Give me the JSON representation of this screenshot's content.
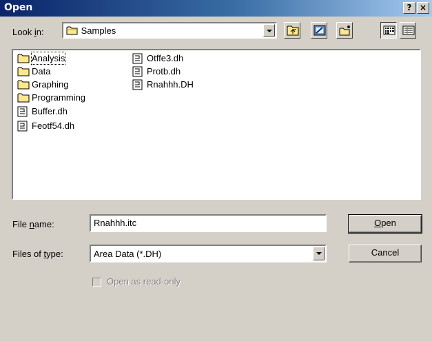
{
  "window": {
    "title": "Open"
  },
  "titlebar": {
    "help_label": "?",
    "close_label": "×"
  },
  "lookin": {
    "label_pre": "Look ",
    "label_u": "i",
    "label_post": "n:",
    "value": "Samples",
    "folder_icon": "folder-icon"
  },
  "toolbar": {
    "buttons": [
      "up-one-level",
      "desktop",
      "new-folder",
      "list-view",
      "details-view"
    ],
    "active_view": "list-view"
  },
  "files": {
    "column1": [
      {
        "name": "Analysis",
        "icon": "folder-icon"
      },
      {
        "name": "Data",
        "icon": "folder-icon"
      },
      {
        "name": "Graphing",
        "icon": "folder-icon"
      },
      {
        "name": "Programming",
        "icon": "folder-icon"
      },
      {
        "name": "Buffer.dh",
        "icon": "document-icon"
      },
      {
        "name": "Feotf54.dh",
        "icon": "document-icon"
      }
    ],
    "column2": [
      {
        "name": "Otffe3.dh",
        "icon": "document-icon"
      },
      {
        "name": "Protb.dh",
        "icon": "document-icon"
      },
      {
        "name": "Rnahhh.DH",
        "icon": "document-icon"
      }
    ]
  },
  "filename": {
    "label_pre": "File ",
    "label_u": "n",
    "label_post": "ame:",
    "value": "Rnahhh.itc"
  },
  "filetype": {
    "label_pre": "Files of ",
    "label_u": "t",
    "label_post": "ype:",
    "value": "Area Data (*.DH)"
  },
  "buttons": {
    "open_u": "O",
    "open_rest": "pen",
    "cancel": "Cancel"
  },
  "readonly": {
    "label": "Open as read-only",
    "checked": false,
    "enabled": false
  },
  "colors": {
    "titlebar_start": "#0a246a",
    "titlebar_end": "#a6caf0",
    "face": "#d4d0c8",
    "folder": "#ffe88c"
  }
}
